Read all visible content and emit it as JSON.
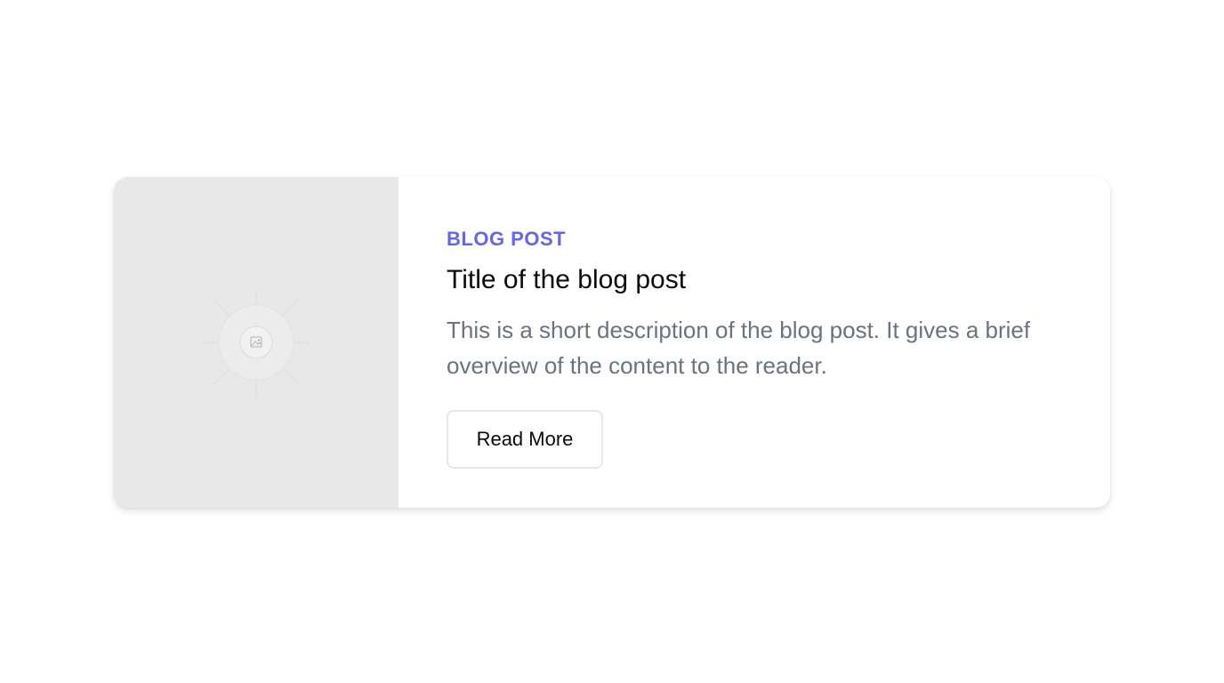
{
  "card": {
    "eyebrow": "BLOG POST",
    "title": "Title of the blog post",
    "description": "This is a short description of the blog post. It gives a brief overview of the content to the reader.",
    "button_label": "Read More",
    "image_icon": "image-placeholder-icon"
  },
  "colors": {
    "accent": "#6366f1",
    "description_text": "#6b7280",
    "image_bg": "#e8e8e8"
  }
}
